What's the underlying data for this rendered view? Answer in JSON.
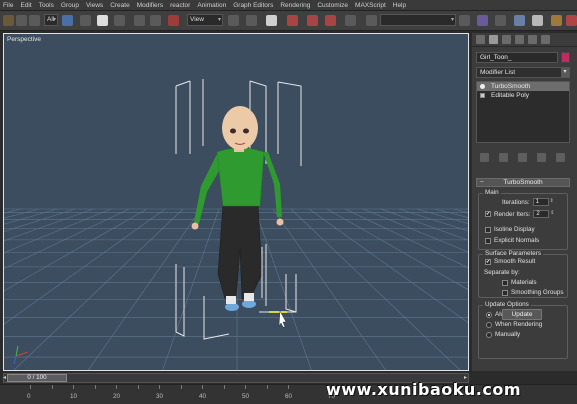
{
  "menu": {
    "items": [
      "File",
      "Edit",
      "Tools",
      "Group",
      "Views",
      "Create",
      "Modifiers",
      "reactor",
      "Animation",
      "Graph Editors",
      "Rendering",
      "Customize",
      "MAXScript",
      "Help"
    ]
  },
  "toolbar": {
    "selection_filter": "All",
    "reference_coord": "View"
  },
  "viewport": {
    "label": "Perspective",
    "background_color": "#3b4d5f",
    "shirt_color": "#2f9a2f",
    "pants_color": "#2a2a2a"
  },
  "command_panel": {
    "object_name": "Girl_Toon_",
    "object_color": "#c22a63",
    "modifier_list_label": "Modifier List",
    "stack": [
      {
        "label": "TurboSmooth",
        "selected": true,
        "icon": "lightbulb-icon"
      },
      {
        "label": "Editable Poly",
        "selected": false,
        "icon": "square-icon"
      }
    ],
    "rollout_title": "TurboSmooth",
    "main": {
      "title": "Main",
      "iterations_label": "Iterations:",
      "iterations_value": "1",
      "render_iters_label": "Render Iters:",
      "render_iters_value": "2",
      "render_iters_checked": true,
      "isoline_label": "Isoline Display",
      "isoline_checked": false,
      "explicit_normals_label": "Explicit Normals",
      "explicit_normals_checked": false
    },
    "surface": {
      "title": "Surface Parameters",
      "smooth_result_label": "Smooth Result",
      "smooth_result_checked": true,
      "separate_by_label": "Separate by:",
      "materials_label": "Materials",
      "smoothing_groups_label": "Smoothing Groups"
    },
    "update": {
      "title": "Update Options",
      "options": [
        "Always",
        "When Rendering",
        "Manually"
      ],
      "selected": "Always",
      "button_label": "Update"
    }
  },
  "timeline": {
    "frame_display": "0 / 100",
    "ticks": [
      "0",
      "10",
      "20",
      "30",
      "40",
      "50",
      "60",
      "70"
    ]
  },
  "watermark": "www.xunibaoku.com"
}
